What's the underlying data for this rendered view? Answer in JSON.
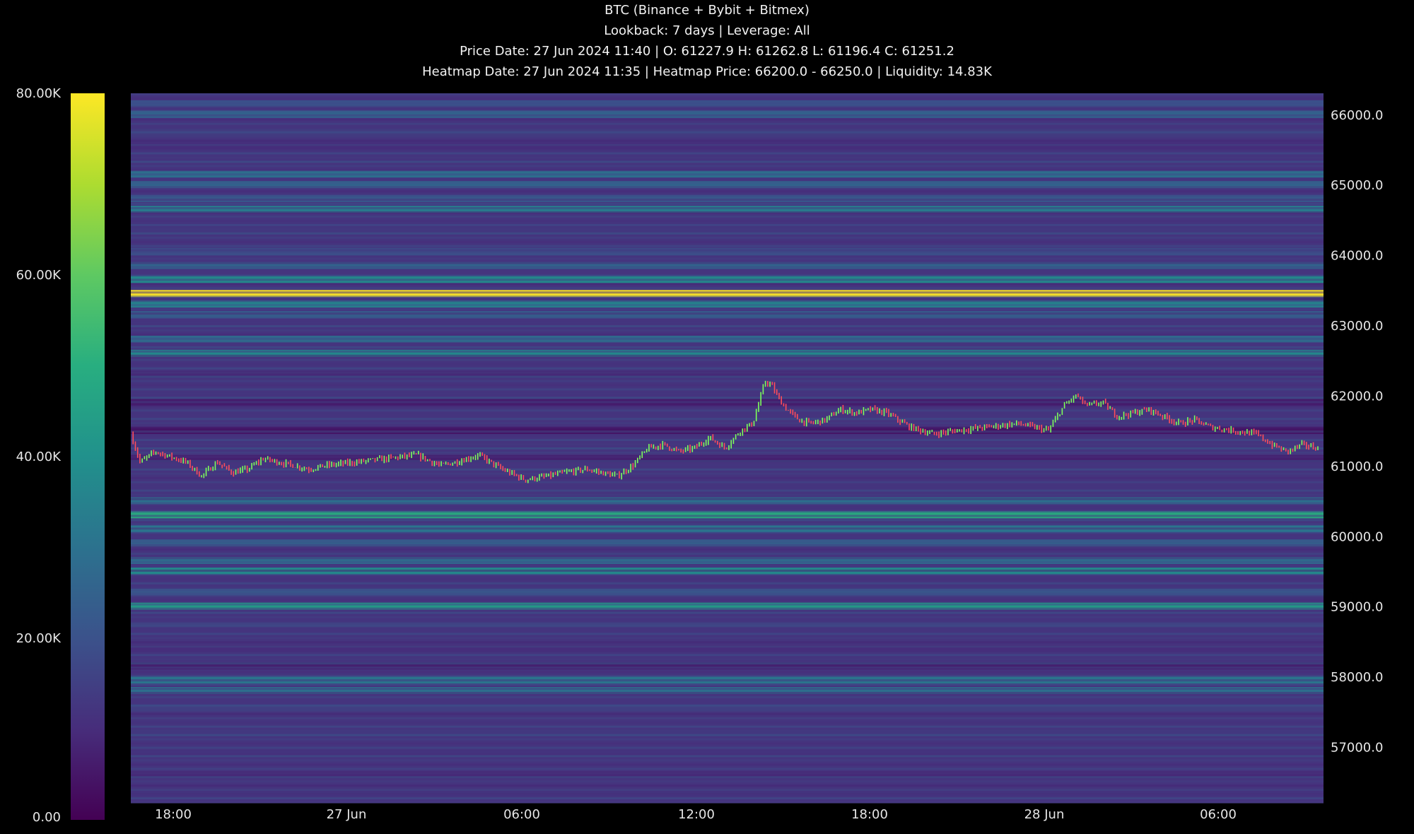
{
  "header": {
    "title": "BTC (Binance + Bybit + Bitmex)",
    "subtitle": "Lookback: 7 days | Leverage: All",
    "price_info": "Price Date: 27 Jun 2024 11:40 | O: 61227.9 H: 61262.8 L: 61196.4 C: 61251.2",
    "heatmap_info": "Heatmap Date: 27 Jun 2024 11:35 | Heatmap Price: 66200.0 - 66250.0 | Liquidity: 14.83K"
  },
  "colors": {
    "background": "#000000",
    "bull": "#7dff5a",
    "bear": "#ff4d5a",
    "scale": [
      "#440154",
      "#472d7b",
      "#3b528b",
      "#2c728e",
      "#21918c",
      "#28ae80",
      "#5ec962",
      "#addc30",
      "#fde725"
    ]
  },
  "chart_data": {
    "type": "heatmap",
    "title": "BTC (Binance + Bybit + Bitmex)",
    "colorbar": {
      "range": [
        0,
        80000
      ],
      "tick_values": [
        0,
        20000,
        40000,
        60000,
        80000
      ],
      "tick_labels": [
        "0.00",
        "20.00K",
        "40.00K",
        "60.00K",
        "80.00K"
      ]
    },
    "y_axis": {
      "range": [
        56200,
        66300
      ],
      "tick_values": [
        57000,
        58000,
        59000,
        60000,
        61000,
        62000,
        63000,
        64000,
        65000,
        66000
      ],
      "tick_labels": [
        "57000.0",
        "58000.0",
        "59000.0",
        "60000.0",
        "61000.0",
        "62000.0",
        "63000.0",
        "64000.0",
        "65000.0",
        "66000.0"
      ],
      "position": "right"
    },
    "x_axis": {
      "range_hours": [
        -6.6,
        34.4
      ],
      "tick_labels": [
        "18:00",
        "27 Jun",
        "06:00",
        "12:00",
        "18:00",
        "28 Jun",
        "06:00"
      ],
      "tick_hours": [
        0,
        6,
        12,
        18,
        24,
        30,
        36
      ]
    },
    "liquidity_bands": [
      {
        "price": 66150,
        "value": 20000
      },
      {
        "price": 66000,
        "value": 26000
      },
      {
        "price": 65750,
        "value": 14000
      },
      {
        "price": 65550,
        "value": 10000
      },
      {
        "price": 65150,
        "value": 30000
      },
      {
        "price": 65000,
        "value": 26000
      },
      {
        "price": 64800,
        "value": 22000
      },
      {
        "price": 64650,
        "value": 34000
      },
      {
        "price": 64350,
        "value": 13000
      },
      {
        "price": 64050,
        "value": 18000
      },
      {
        "price": 63850,
        "value": 26000
      },
      {
        "price": 63650,
        "value": 38000
      },
      {
        "price": 63450,
        "value": 80000
      },
      {
        "price": 63300,
        "value": 36000
      },
      {
        "price": 63150,
        "value": 24000
      },
      {
        "price": 62800,
        "value": 28000
      },
      {
        "price": 62600,
        "value": 38000
      },
      {
        "price": 62300,
        "value": 9000
      },
      {
        "price": 61900,
        "value": 6000
      },
      {
        "price": 61500,
        "value": 4000
      },
      {
        "price": 61100,
        "value": 7000
      },
      {
        "price": 60500,
        "value": 30000
      },
      {
        "price": 60300,
        "value": 50000
      },
      {
        "price": 60100,
        "value": 32000
      },
      {
        "price": 59900,
        "value": 24000
      },
      {
        "price": 59650,
        "value": 28000
      },
      {
        "price": 59500,
        "value": 38000
      },
      {
        "price": 59200,
        "value": 20000
      },
      {
        "price": 59000,
        "value": 44000
      },
      {
        "price": 58750,
        "value": 16000
      },
      {
        "price": 58400,
        "value": 10000
      },
      {
        "price": 58150,
        "value": 7000
      },
      {
        "price": 57950,
        "value": 32000
      },
      {
        "price": 57800,
        "value": 30000
      },
      {
        "price": 57550,
        "value": 15000
      },
      {
        "price": 57200,
        "value": 13000
      },
      {
        "price": 56900,
        "value": 11000
      },
      {
        "price": 56600,
        "value": 9000
      },
      {
        "price": 56350,
        "value": 12000
      }
    ],
    "price_path": [
      {
        "h": -6.6,
        "p": 61450
      },
      {
        "h": -6.0,
        "p": 61050
      },
      {
        "h": -5.0,
        "p": 61200
      },
      {
        "h": -3.0,
        "p": 61050
      },
      {
        "h": -2.0,
        "p": 60850
      },
      {
        "h": -1.0,
        "p": 61050
      },
      {
        "h": 0.0,
        "p": 60900
      },
      {
        "h": 1.0,
        "p": 60950
      },
      {
        "h": 2.0,
        "p": 61100
      },
      {
        "h": 4.0,
        "p": 61000
      },
      {
        "h": 5.0,
        "p": 60950
      },
      {
        "h": 6.0,
        "p": 61000
      },
      {
        "h": 8.0,
        "p": 61050
      },
      {
        "h": 10.0,
        "p": 61100
      },
      {
        "h": 12.0,
        "p": 61150
      },
      {
        "h": 13.5,
        "p": 61000
      },
      {
        "h": 14.5,
        "p": 61050
      },
      {
        "h": 16.0,
        "p": 61150
      },
      {
        "h": 17.5,
        "p": 60950
      },
      {
        "h": 19.0,
        "p": 60800
      },
      {
        "h": 20.5,
        "p": 60850
      },
      {
        "h": 21.5,
        "p": 60900
      },
      {
        "h": 23.0,
        "p": 60950
      },
      {
        "h": 25.0,
        "p": 60850
      },
      {
        "h": 26.0,
        "p": 61000
      },
      {
        "h": 27.0,
        "p": 61250
      },
      {
        "h": 28.0,
        "p": 61300
      },
      {
        "h": 29.0,
        "p": 61200
      },
      {
        "h": 30.0,
        "p": 61250
      },
      {
        "h": 31.0,
        "p": 61400
      },
      {
        "h": 32.0,
        "p": 61250
      },
      {
        "h": 33.0,
        "p": 61500
      },
      {
        "h": 33.8,
        "p": 61600
      },
      {
        "h": 34.2,
        "p": 61900
      },
      {
        "h": 34.6,
        "p": 62200
      },
      {
        "h": 35.0,
        "p": 62150
      },
      {
        "h": 35.5,
        "p": 61950
      },
      {
        "h": 36.0,
        "p": 61800
      },
      {
        "h": 36.8,
        "p": 61650
      },
      {
        "h": 37.5,
        "p": 61600
      },
      {
        "h": 38.5,
        "p": 61650
      },
      {
        "h": 39.5,
        "p": 61800
      },
      {
        "h": 40.5,
        "p": 61750
      },
      {
        "h": 41.5,
        "p": 61800
      },
      {
        "h": 42.5,
        "p": 61750
      },
      {
        "h": 44.0,
        "p": 61550
      },
      {
        "h": 45.5,
        "p": 61450
      },
      {
        "h": 47.0,
        "p": 61500
      },
      {
        "h": 49.0,
        "p": 61550
      },
      {
        "h": 51.0,
        "p": 61600
      },
      {
        "h": 53.0,
        "p": 61500
      },
      {
        "h": 54.0,
        "p": 61850
      },
      {
        "h": 54.8,
        "p": 62000
      },
      {
        "h": 55.5,
        "p": 61850
      },
      {
        "h": 56.5,
        "p": 61900
      },
      {
        "h": 57.5,
        "p": 61700
      },
      {
        "h": 58.5,
        "p": 61750
      },
      {
        "h": 59.5,
        "p": 61800
      },
      {
        "h": 60.5,
        "p": 61700
      },
      {
        "h": 61.5,
        "p": 61600
      },
      {
        "h": 62.5,
        "p": 61650
      },
      {
        "h": 63.5,
        "p": 61550
      },
      {
        "h": 65.0,
        "p": 61500
      },
      {
        "h": 66.5,
        "p": 61450
      },
      {
        "h": 67.5,
        "p": 61300
      },
      {
        "h": 68.5,
        "p": 61200
      },
      {
        "h": 69.5,
        "p": 61300
      },
      {
        "h": 70.5,
        "p": 61250
      }
    ]
  }
}
